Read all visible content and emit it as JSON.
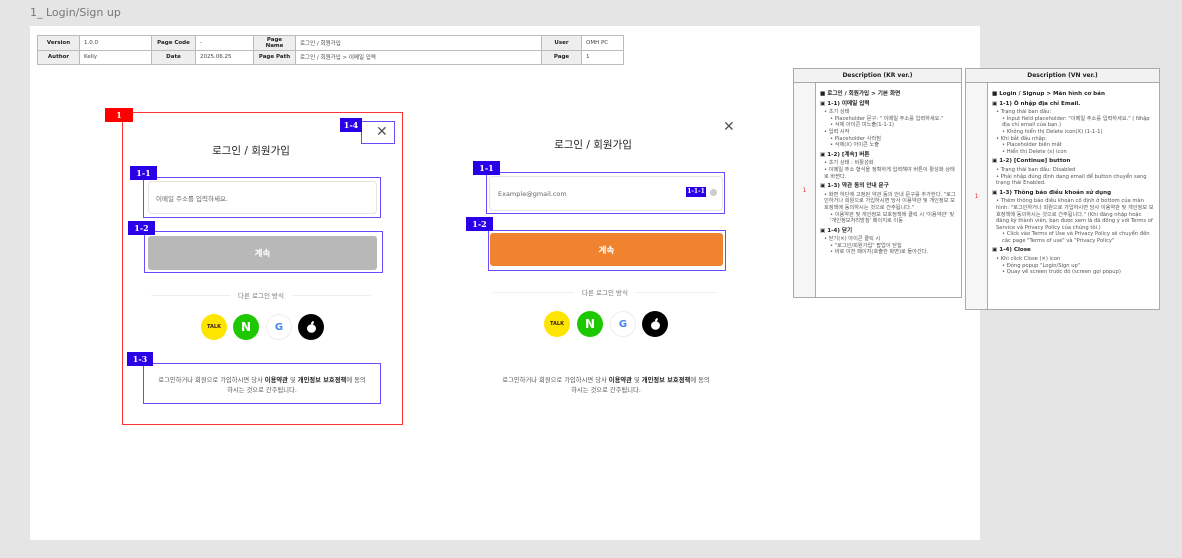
{
  "frame_label": "1_ Login/Sign up",
  "meta": {
    "version_label": "Version",
    "version": "1.0.0",
    "page_code_label": "Page Code",
    "page_code": "-",
    "page_name_label": "Page Name",
    "page_name": "로그인 / 회원가입",
    "user_label": "User",
    "user": "OMH PC",
    "author_label": "Author",
    "author": "Kelly",
    "date_label": "Date",
    "date": "2025.06.25",
    "page_path_label": "Page Path",
    "page_path": "로그인 / 회원가입 > 이메일 입력",
    "page_label": "Page",
    "page": "1"
  },
  "tags": {
    "t1": "1",
    "t11": "1-1",
    "t12": "1-2",
    "t13": "1-3",
    "t14": "1-4",
    "t111": "1-1-1"
  },
  "modal": {
    "title": "로그인 / 회원가입",
    "email_placeholder": "이메일 주소를 입력하세요.",
    "email_value": "Example@gmail.com",
    "continue": "계속",
    "divider": "다른 로그인 방식",
    "close": "✕",
    "social": {
      "kakao": "TALK",
      "naver": "N",
      "google": "G",
      "apple": ""
    },
    "terms_pre": "로그인하거나 회원으로 가입하시면 당사 ",
    "terms_link": "이용약관",
    "terms_mid": " 및 ",
    "privacy_link": "개인정보 보호정책",
    "terms_post": "에 동의",
    "terms_line2": "하시는 것으로 간주됩니다."
  },
  "colors": {
    "accent": "#ef8330",
    "disabled": "#b8b8b8",
    "tag": "#2a00e8",
    "frame": "#ff0000"
  },
  "desc_kr": {
    "header": "Description (KR ver.)",
    "num": "1",
    "lines": [
      {
        "c": "sec",
        "t": "■ 로그인 / 회원가입 > 기본 화면"
      },
      {
        "c": "sec",
        "t": "▣ 1-1) 이메일 입력"
      },
      {
        "c": "l1",
        "t": "• 초기 상태"
      },
      {
        "c": "l2",
        "t": "• Placeholder 문구: \" 이메일 주소를 입력하세요.\""
      },
      {
        "c": "l2",
        "t": "• 삭제 아이콘 미노출(1-1-1)"
      },
      {
        "c": "l1",
        "t": "• 입력 시작"
      },
      {
        "c": "l2",
        "t": "• Placeholder 사라짐"
      },
      {
        "c": "l2",
        "t": "• 삭제(X) 아이콘 노출"
      },
      {
        "c": "sec",
        "t": "▣ 1-2) [계속] 버튼"
      },
      {
        "c": "l1",
        "t": "• 초기 상태 : 비활성화"
      },
      {
        "c": "l1",
        "t": "• 이메일 주소 형식을 정확하게 입력해야 버튼이 활성화 상태로 바뀐다."
      },
      {
        "c": "sec",
        "t": "▣ 1-3) 약관 동의 안내 문구"
      },
      {
        "c": "l1",
        "t": "• 화면 하단에 고정된 약관 동의 안내 문구를 추가한다. \"로그인하거나 회원으로 가입하시면 당사 이용약관 및 개인정보 보호정책에 동의하시는 것으로 간주됩니다.\""
      },
      {
        "c": "l2",
        "t": "• 이용약관 및 개인정보 보호정책에 클릭 시 '이용약관' 및 '개인정보처리방침' 페이지로 이동"
      },
      {
        "c": "sec",
        "t": "▣ 1-4) 닫기"
      },
      {
        "c": "l1",
        "t": "• 닫기(✕) 아이콘 클릭 시"
      },
      {
        "c": "l2",
        "t": "• \"로그인/회원가입\" 팝업이 닫힘"
      },
      {
        "c": "l2",
        "t": "• 바로 이전 페이지(호출한 화면)로 돌아간다."
      }
    ]
  },
  "desc_vn": {
    "header": "Description (VN ver.)",
    "num": "1",
    "lines": [
      {
        "c": "sec",
        "t": "■ Login / Signup > Màn hình cơ bản"
      },
      {
        "c": "sec",
        "t": "▣ 1-1) Ô nhập địa chỉ Email."
      },
      {
        "c": "l1",
        "t": "• Trạng thái ban đầu:"
      },
      {
        "c": "l2",
        "t": "• Input field placeholder: \"이메일 주소를 입력하세요.\" ( Nhập địa chỉ email của bạn.)"
      },
      {
        "c": "l2",
        "t": "• Không hiển thị Delete icon(X) (1-1-1)"
      },
      {
        "c": "l1",
        "t": "• Khi bắt đầu nhập:"
      },
      {
        "c": "l2",
        "t": "• Placeholder biến mất"
      },
      {
        "c": "l2",
        "t": "• Hiển thị Delete (x) icon"
      },
      {
        "c": "sec",
        "t": "▣ 1-2) [Continue] button"
      },
      {
        "c": "l1",
        "t": "• Trạng thái ban đầu: Disabled"
      },
      {
        "c": "l1",
        "t": "• Phải nhập đúng định dạng email để button chuyển sang trạng thái Enabled."
      },
      {
        "c": "sec",
        "t": "▣ 1-3) Thông báo điều khoản sử dụng"
      },
      {
        "c": "l1",
        "t": "• Thêm thông báo điều khoản cố định ở bottom của màn hình: \"로그인하거나 회원으로 가입하시면 당사 이용약관 및 개인정보 보호정책에 동의하시는 것으로 간주됩니다.\" (Khi đăng nhập hoặc đăng ký thành viên, bạn được xem là đã đồng ý với Terms of Service và Privacy Policy của chúng tôi.)"
      },
      {
        "c": "l2",
        "t": "• Click vào Terms of Use và Privacy Policy sẽ chuyển đến các page \"Terms of use\" và \"Privacy Policy\""
      },
      {
        "c": "sec",
        "t": "▣ 1-4) Close"
      },
      {
        "c": "l1",
        "t": "• Khi click Close (✕) icon"
      },
      {
        "c": "l2",
        "t": "• Đóng popup \"Login/Sign up\""
      },
      {
        "c": "l2",
        "t": "• Quay về screen trước đó (screen gọi popup)"
      }
    ]
  }
}
